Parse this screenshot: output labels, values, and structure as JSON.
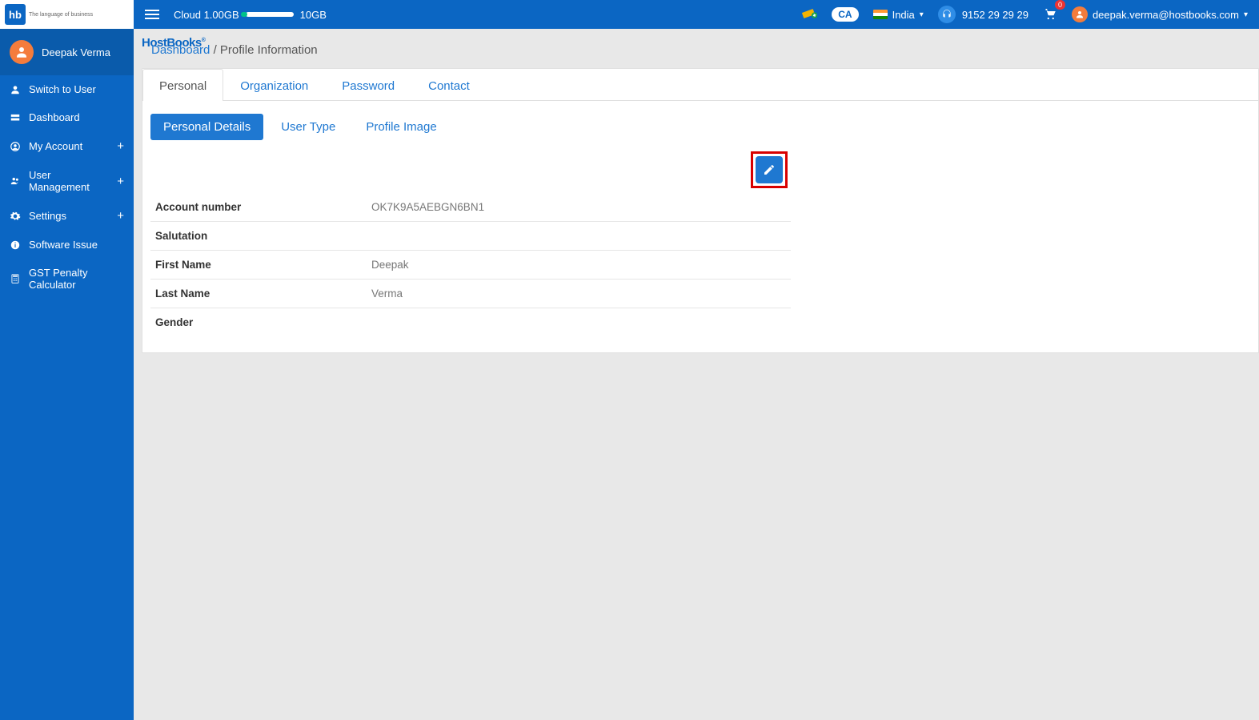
{
  "brand": {
    "name": "HostBooks",
    "tagline": "The language of business"
  },
  "header": {
    "cloud_used": "Cloud 1.00GB",
    "cloud_total": "10GB",
    "country": "India",
    "phone": "9152 29 29 29",
    "cart_count": "0",
    "user_email": "deepak.verma@hostbooks.com"
  },
  "sidebar": {
    "user_name": "Deepak Verma",
    "items": [
      {
        "label": "Switch to User",
        "expandable": false
      },
      {
        "label": "Dashboard",
        "expandable": false
      },
      {
        "label": "My Account",
        "expandable": true
      },
      {
        "label": "User Management",
        "expandable": true
      },
      {
        "label": "Settings",
        "expandable": true
      },
      {
        "label": "Software Issue",
        "expandable": false
      },
      {
        "label": "GST Penalty Calculator",
        "expandable": false
      }
    ]
  },
  "breadcrumb": {
    "root": "Dashboard",
    "current": "Profile Information"
  },
  "tabs": [
    "Personal",
    "Organization",
    "Password",
    "Contact"
  ],
  "subtabs": [
    "Personal Details",
    "User Type",
    "Profile Image"
  ],
  "details": [
    {
      "label": "Account number",
      "value": "OK7K9A5AEBGN6BN1"
    },
    {
      "label": "Salutation",
      "value": ""
    },
    {
      "label": "First Name",
      "value": "Deepak"
    },
    {
      "label": "Last Name",
      "value": "Verma"
    },
    {
      "label": "Gender",
      "value": ""
    }
  ]
}
